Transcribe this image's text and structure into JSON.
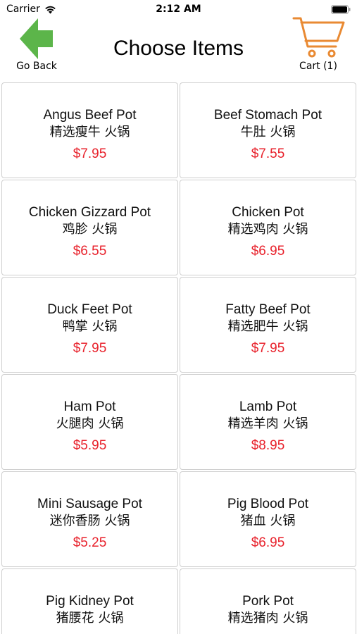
{
  "status_bar": {
    "carrier": "Carrier",
    "time": "2:12 AM"
  },
  "nav": {
    "back_label": "Go Back",
    "title": "Choose Items",
    "cart_label": "Cart (1)"
  },
  "colors": {
    "back_arrow": "#5cb54a",
    "cart": "#e98a33",
    "price": "#e8222c"
  },
  "icons": {
    "back": "arrow-left-icon",
    "cart": "shopping-cart-icon",
    "wifi": "wifi-icon",
    "battery": "battery-icon"
  },
  "items": [
    {
      "name": "Angus Beef Pot",
      "name_cn": "精选瘦牛 火锅",
      "price": "$7.95"
    },
    {
      "name": "Beef Stomach Pot",
      "name_cn": "牛肚 火锅",
      "price": "$7.55"
    },
    {
      "name": "Chicken Gizzard Pot",
      "name_cn": "鸡胗 火锅",
      "price": "$6.55"
    },
    {
      "name": "Chicken Pot",
      "name_cn": "精选鸡肉 火锅",
      "price": "$6.95"
    },
    {
      "name": "Duck Feet Pot",
      "name_cn": "鸭掌 火锅",
      "price": "$7.95"
    },
    {
      "name": "Fatty Beef Pot",
      "name_cn": "精选肥牛 火锅",
      "price": "$7.95"
    },
    {
      "name": "Ham Pot",
      "name_cn": "火腿肉 火锅",
      "price": "$5.95"
    },
    {
      "name": "Lamb Pot",
      "name_cn": "精选羊肉 火锅",
      "price": "$8.95"
    },
    {
      "name": "Mini Sausage Pot",
      "name_cn": "迷你香肠 火锅",
      "price": "$5.25"
    },
    {
      "name": "Pig Blood Pot",
      "name_cn": "猪血 火锅",
      "price": "$6.95"
    },
    {
      "name": "Pig Kidney Pot",
      "name_cn": "猪腰花 火锅",
      "price": ""
    },
    {
      "name": "Pork Pot",
      "name_cn": "精选猪肉 火锅",
      "price": ""
    }
  ]
}
